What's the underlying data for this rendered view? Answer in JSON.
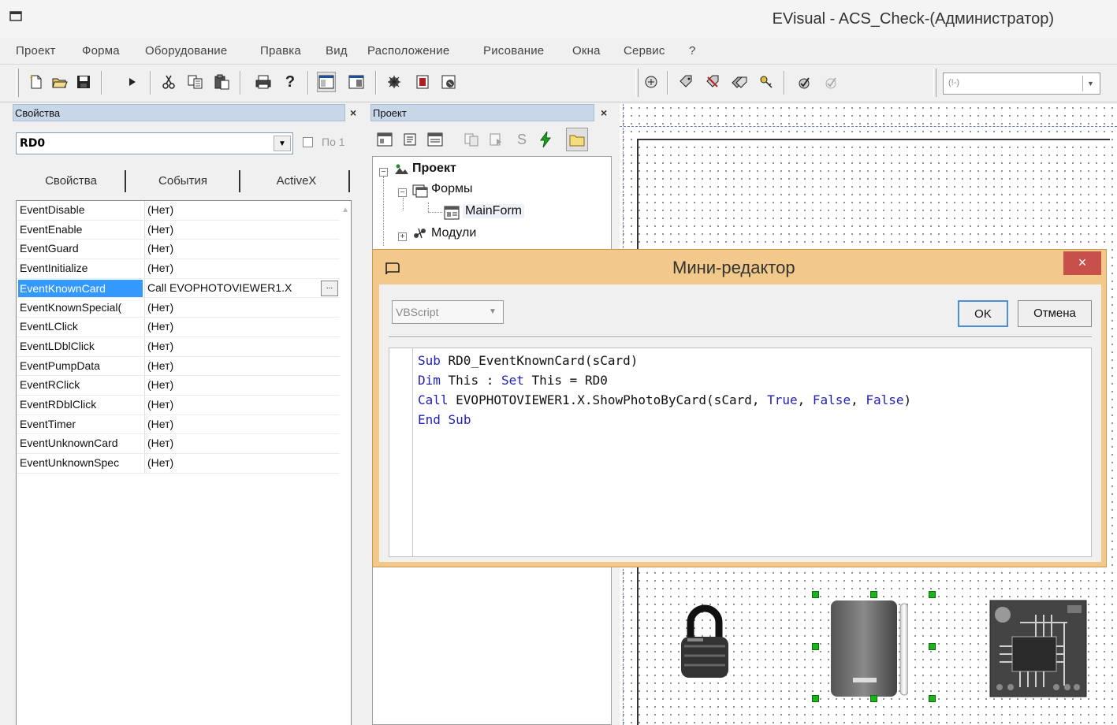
{
  "window": {
    "title": "EVisual - ACS_Check-(Администратор)"
  },
  "menu": [
    "Проект",
    "Форма",
    "Оборудование",
    "Правка",
    "Вид",
    "Расположение",
    "Рисование",
    "Окна",
    "Сервис",
    "?"
  ],
  "toolbar": {
    "icons": [
      "new-icon",
      "open-icon",
      "save-icon",
      "run-icon",
      "cut-icon",
      "copy-icon",
      "paste-icon",
      "print-icon",
      "help-icon",
      "properties-window-icon",
      "project-window-icon",
      "debug-icon",
      "stop-icon",
      "script-icon",
      "plugin-icon",
      "tag-icon",
      "tag-delete-icon",
      "tag-multi-icon",
      "key-icon",
      "check-icon",
      "check-disabled-icon"
    ],
    "combo_value": "(!-)"
  },
  "properties": {
    "title": "Свойства",
    "close": "×",
    "object": "RD0",
    "po_label": "По 1",
    "tabs": [
      "Свойства",
      "События",
      "ActiveX"
    ],
    "rows": [
      {
        "key": "EventDisable",
        "value": "(Нет)"
      },
      {
        "key": "EventEnable",
        "value": "(Нет)"
      },
      {
        "key": "EventGuard",
        "value": "(Нет)"
      },
      {
        "key": "EventInitialize",
        "value": "(Нет)"
      },
      {
        "key": "EventKnownCard",
        "value": "Call EVOPHOTOVIEWER1.X",
        "selected": true
      },
      {
        "key": "EventKnownSpecial(",
        "value": "(Нет)"
      },
      {
        "key": "EventLClick",
        "value": "(Нет)"
      },
      {
        "key": "EventLDblClick",
        "value": "(Нет)"
      },
      {
        "key": "EventPumpData",
        "value": "(Нет)"
      },
      {
        "key": "EventRClick",
        "value": "(Нет)"
      },
      {
        "key": "EventRDblClick",
        "value": "(Нет)"
      },
      {
        "key": "EventTimer",
        "value": "(Нет)"
      },
      {
        "key": "EventUnknownCard",
        "value": "(Нет)"
      },
      {
        "key": "EventUnknownSpec",
        "value": "(Нет)"
      }
    ],
    "ellipsis": "..."
  },
  "project": {
    "title": "Проект",
    "close": "×",
    "tree": {
      "root": "Проект",
      "forms": "Формы",
      "mainform": "MainForm",
      "modules": "Модули"
    }
  },
  "dialog": {
    "title": "Мини-редактор",
    "close": "×",
    "language": "VBScript",
    "ok": "OK",
    "cancel": "Отмена",
    "code": [
      [
        {
          "t": "Sub",
          "kw": true
        },
        {
          "t": " RD0_EventKnownCard(sCard)"
        }
      ],
      [
        {
          "t": "Dim",
          "kw": true
        },
        {
          "t": " This : "
        },
        {
          "t": "Set",
          "kw": true
        },
        {
          "t": " This = RD0"
        }
      ],
      [
        {
          "t": "Call",
          "kw": true
        },
        {
          "t": " EVOPHOTOVIEWER1.X.ShowPhotoByCard(sCard, "
        },
        {
          "t": "True",
          "kw": true
        },
        {
          "t": ", "
        },
        {
          "t": "False",
          "kw": true
        },
        {
          "t": ", "
        },
        {
          "t": "False",
          "kw": true
        },
        {
          "t": ")"
        }
      ],
      [
        {
          "t": "End",
          "kw": true
        },
        {
          "t": " "
        },
        {
          "t": "Sub",
          "kw": true
        }
      ]
    ]
  },
  "colors": {
    "keyword": "#1f1fb8",
    "selection": "#3399ff",
    "dialog_frame": "#f2c98a",
    "dialog_close": "#c7504a",
    "handle": "#1db31d"
  }
}
